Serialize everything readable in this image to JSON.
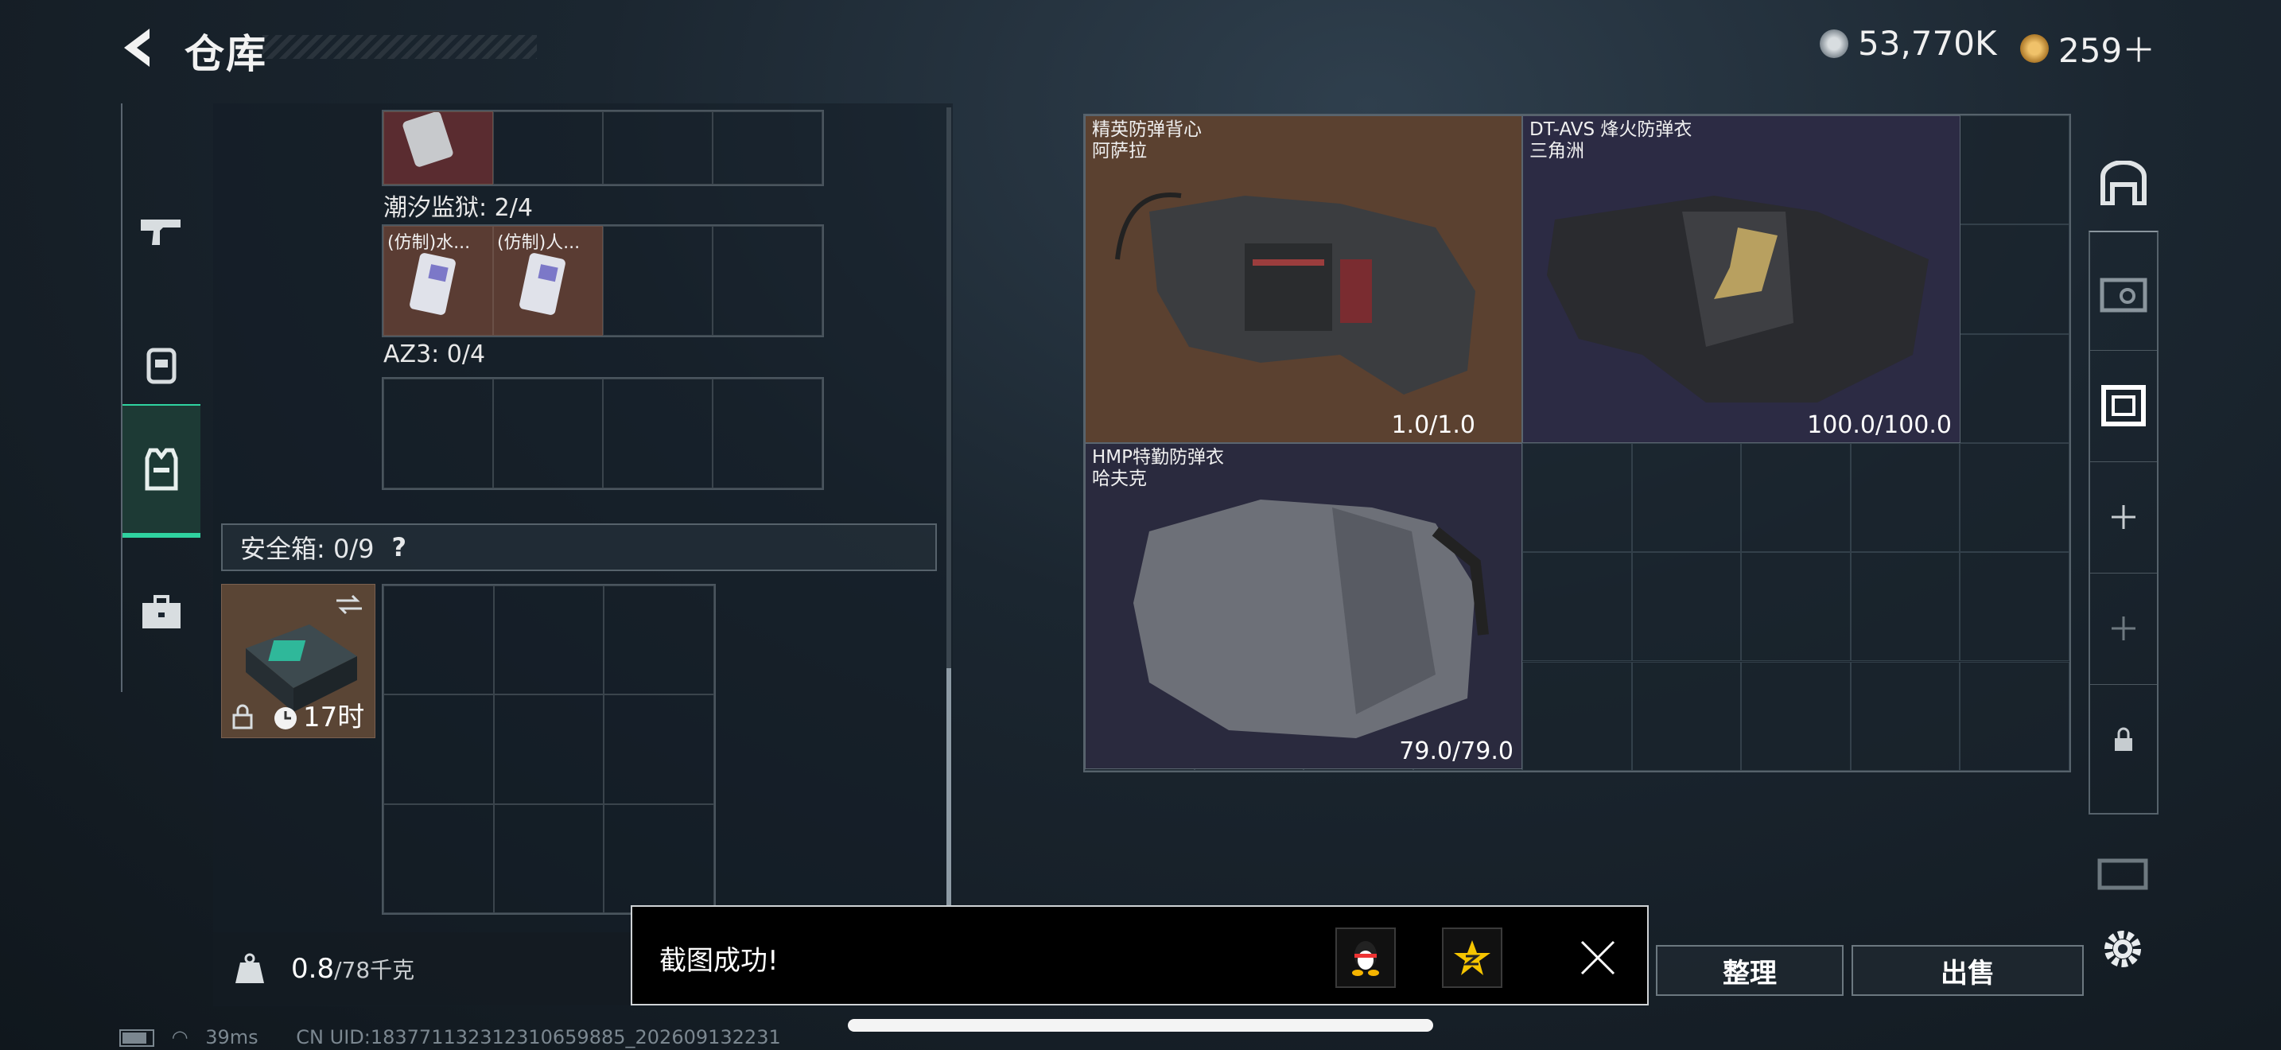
{
  "header": {
    "title": "仓库",
    "currency1": "53,770K",
    "currency2": "259＋"
  },
  "left": {
    "row1_label": "潮汐监狱: 2/4",
    "row1_items": [
      "(仿制)水...",
      "(仿制)人..."
    ],
    "row2_label": "AZ3: 0/4",
    "safe_label": "安全箱:  0/9",
    "safe_help": "?",
    "safe_time": "17时"
  },
  "weight": {
    "value": "0.8",
    "unit": "/78千克"
  },
  "items": [
    {
      "name1": "精英防弹背心",
      "name2": "阿萨拉",
      "durability": "1.0/1.0"
    },
    {
      "name1": "DT-AVS 烽火防弹衣",
      "name2": "三角洲",
      "durability": "100.0/100.0"
    },
    {
      "name1": "HMP特勤防弹衣",
      "name2": "哈夫克",
      "durability": "79.0/79.0"
    }
  ],
  "buttons": {
    "sort": "整理",
    "sell": "出售"
  },
  "toast": {
    "message": "截图成功!"
  },
  "status": {
    "ping": "39ms",
    "uid": "CN UID:18377113231231065988​5_20260913​2231"
  },
  "colors": {
    "accent": "#2fd3a0",
    "item_asara": "#5b4130",
    "item_delta": "#2c2b44",
    "item_haavk": "#2a2a3e"
  }
}
